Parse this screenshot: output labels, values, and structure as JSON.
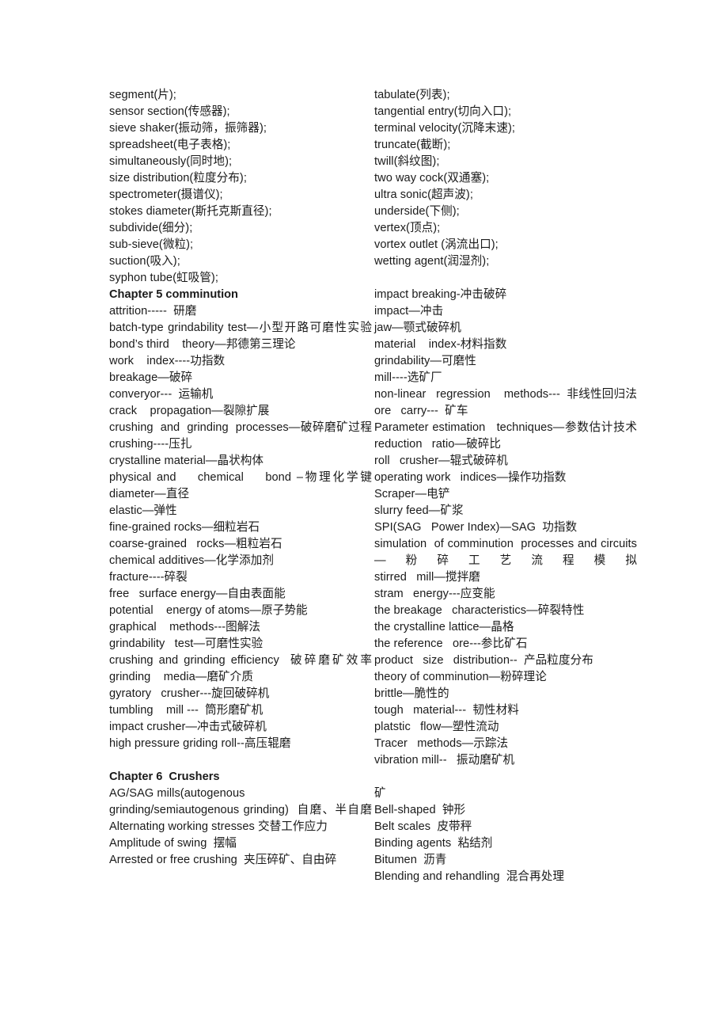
{
  "document": {
    "type": "bilingual-glossary",
    "language_pair": "English-Chinese",
    "page_background": "#ffffff",
    "text_color": "#1a1a1a"
  },
  "left_column": {
    "blocks": [
      {
        "kind": "entry",
        "text": "segment(片);"
      },
      {
        "kind": "entry",
        "text": "sensor section(传感器);"
      },
      {
        "kind": "entry",
        "text": "sieve shaker(振动筛，振筛器);"
      },
      {
        "kind": "entry",
        "text": "spreadsheet(电子表格);"
      },
      {
        "kind": "entry",
        "text": "simultaneously(同时地);"
      },
      {
        "kind": "entry",
        "text": "size distribution(粒度分布);"
      },
      {
        "kind": "entry",
        "text": "spectrometer(摄谱仪);"
      },
      {
        "kind": "entry",
        "text": "stokes diameter(斯托克斯直径);"
      },
      {
        "kind": "entry",
        "text": "subdivide(细分);"
      },
      {
        "kind": "entry",
        "text": "sub-sieve(微粒);"
      },
      {
        "kind": "entry",
        "text": "suction(吸入);"
      },
      {
        "kind": "entry",
        "text": "syphon tube(虹吸管);"
      },
      {
        "kind": "heading",
        "text": "Chapter 5 comminution"
      },
      {
        "kind": "entry",
        "text": "attrition-----  研磨"
      },
      {
        "kind": "entry",
        "text": "batch-type grindability test—小型开路可磨性实验",
        "justified": true
      },
      {
        "kind": "entry",
        "text": "bond’s third    theory—邦德第三理论"
      },
      {
        "kind": "entry",
        "text": "work    index----功指数"
      },
      {
        "kind": "entry",
        "text": "breakage—破碎"
      },
      {
        "kind": "entry",
        "text": "converyor---  运输机"
      },
      {
        "kind": "entry",
        "text": "crack    propagation—裂隙扩展"
      },
      {
        "kind": "entry",
        "text": "crushing  and  grinding  processes—破碎磨矿过程",
        "justified": true
      },
      {
        "kind": "entry",
        "text": "crushing----压扎"
      },
      {
        "kind": "entry",
        "text": "crystalline material—晶状构体"
      },
      {
        "kind": "entry",
        "text": "physical and    chemical    bond –物理化学键",
        "justified": true
      },
      {
        "kind": "entry",
        "text": "diameter—直径"
      },
      {
        "kind": "entry",
        "text": "elastic—弹性"
      },
      {
        "kind": "entry",
        "text": "fine-grained rocks—细粒岩石"
      },
      {
        "kind": "entry",
        "text": "coarse-grained   rocks—粗粒岩石"
      },
      {
        "kind": "entry",
        "text": "chemical additives—化学添加剂"
      },
      {
        "kind": "entry",
        "text": "fracture----碎裂"
      },
      {
        "kind": "entry",
        "text": "free   surface energy—自由表面能"
      },
      {
        "kind": "entry",
        "text": "potential    energy of atoms—原子势能"
      },
      {
        "kind": "entry",
        "text": "graphical    methods---图解法"
      },
      {
        "kind": "entry",
        "text": "grindability   test—可磨性实验"
      },
      {
        "kind": "entry",
        "text": "crushing and grinding efficiency  破碎磨矿效率",
        "justified": true
      },
      {
        "kind": "entry",
        "text": "grinding    media—磨矿介质"
      },
      {
        "kind": "entry",
        "text": "gyratory   crusher---旋回破碎机"
      },
      {
        "kind": "entry",
        "text": "tumbling    mill ---  筒形磨矿机"
      },
      {
        "kind": "entry",
        "text": "impact crusher—冲击式破碎机"
      },
      {
        "kind": "entry",
        "text": "high pressure griding roll--高压辊磨"
      },
      {
        "kind": "spacer",
        "text": ""
      },
      {
        "kind": "heading",
        "text": "Chapter 6  Crushers"
      },
      {
        "kind": "entry",
        "text": "AG/SAG mills(autogenous"
      },
      {
        "kind": "entry",
        "text": "grinding/semiautogenous grinding)  自磨、半自磨",
        "justified": true
      },
      {
        "kind": "entry",
        "text": "Alternating working stresses 交替工作应力"
      },
      {
        "kind": "entry",
        "text": "Amplitude of swing  摆幅"
      },
      {
        "kind": "entry",
        "text": "Arrested or free crushing  夹压碎矿、自由碎"
      }
    ]
  },
  "right_column": {
    "blocks": [
      {
        "kind": "entry",
        "text": "tabulate(列表);"
      },
      {
        "kind": "entry",
        "text": "tangential entry(切向入口);"
      },
      {
        "kind": "entry",
        "text": "terminal velocity(沉降末速);"
      },
      {
        "kind": "entry",
        "text": "truncate(截断);"
      },
      {
        "kind": "entry",
        "text": "twill(斜纹图);"
      },
      {
        "kind": "entry",
        "text": "two way cock(双通塞);"
      },
      {
        "kind": "entry",
        "text": "ultra sonic(超声波);"
      },
      {
        "kind": "entry",
        "text": "underside(下侧);"
      },
      {
        "kind": "entry",
        "text": "vertex(顶点);"
      },
      {
        "kind": "entry",
        "text": "vortex outlet (涡流出口);"
      },
      {
        "kind": "entry",
        "text": "wetting agent(润湿剂);"
      },
      {
        "kind": "spacer",
        "text": ""
      },
      {
        "kind": "entry",
        "text": "impact breaking-冲击破碎"
      },
      {
        "kind": "entry",
        "text": "impact—冲击"
      },
      {
        "kind": "entry",
        "text": "jaw—颚式破碎机"
      },
      {
        "kind": "entry",
        "text": "material    index-材料指数"
      },
      {
        "kind": "entry",
        "text": "grindability—可磨性"
      },
      {
        "kind": "entry",
        "text": "mill----选矿厂"
      },
      {
        "kind": "entry",
        "text": "non-linear   regression    methods---  非线性回归法",
        "justified": true
      },
      {
        "kind": "entry",
        "text": "ore   carry---  矿车"
      },
      {
        "kind": "entry",
        "text": "Parameter estimation   techniques—参数估计技术",
        "justified": true
      },
      {
        "kind": "entry",
        "text": "reduction   ratio—破碎比"
      },
      {
        "kind": "entry",
        "text": "roll   crusher—辊式破碎机"
      },
      {
        "kind": "entry",
        "text": "operating work   indices—操作功指数"
      },
      {
        "kind": "entry",
        "text": "Scraper—电铲"
      },
      {
        "kind": "entry",
        "text": "slurry feed—矿浆"
      },
      {
        "kind": "entry",
        "text": "SPI(SAG   Power Index)—SAG  功指数"
      },
      {
        "kind": "entry",
        "text": "simulation  of comminution  processes and circuits—粉碎工艺流程模拟",
        "justified": true
      },
      {
        "kind": "entry",
        "text": "stirred   mill—搅拌磨"
      },
      {
        "kind": "entry",
        "text": "stram   energy---应变能"
      },
      {
        "kind": "entry",
        "text": "the breakage   characteristics—碎裂特性"
      },
      {
        "kind": "entry",
        "text": "the crystalline lattice—晶格"
      },
      {
        "kind": "entry",
        "text": "the reference   ore---参比矿石"
      },
      {
        "kind": "entry",
        "text": "product   size   distribution--  产品粒度分布"
      },
      {
        "kind": "entry",
        "text": "theory of comminution—粉碎理论"
      },
      {
        "kind": "entry",
        "text": "brittle—脆性的"
      },
      {
        "kind": "entry",
        "text": "tough   material---  韧性材料"
      },
      {
        "kind": "entry",
        "text": "platstic   flow—塑性流动"
      },
      {
        "kind": "entry",
        "text": "Tracer   methods—示踪法"
      },
      {
        "kind": "entry",
        "text": "vibration mill--   振动磨矿机"
      },
      {
        "kind": "spacer",
        "text": ""
      },
      {
        "kind": "entry",
        "text": "矿"
      },
      {
        "kind": "entry",
        "text": "Bell-shaped  钟形"
      },
      {
        "kind": "entry",
        "text": "Belt scales  皮带秤"
      },
      {
        "kind": "entry",
        "text": "Binding agents  粘结剂"
      },
      {
        "kind": "entry",
        "text": "Bitumen  沥青"
      },
      {
        "kind": "entry",
        "text": "Blending and rehandling  混合再处理"
      }
    ]
  }
}
